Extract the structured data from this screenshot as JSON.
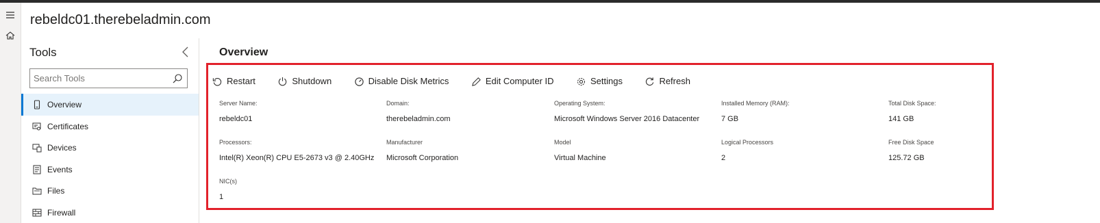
{
  "server": {
    "name": "rebeldc01.therebeladmin.com"
  },
  "tools_pane": {
    "title": "Tools",
    "search_placeholder": "Search Tools",
    "items": [
      {
        "label": "Overview",
        "icon": "server-icon",
        "active": true
      },
      {
        "label": "Certificates",
        "icon": "certificate-icon",
        "active": false
      },
      {
        "label": "Devices",
        "icon": "devices-icon",
        "active": false
      },
      {
        "label": "Events",
        "icon": "events-icon",
        "active": false
      },
      {
        "label": "Files",
        "icon": "files-icon",
        "active": false
      },
      {
        "label": "Firewall",
        "icon": "firewall-icon",
        "active": false
      }
    ]
  },
  "overview": {
    "title": "Overview",
    "toolbar": {
      "restart": "Restart",
      "shutdown": "Shutdown",
      "disable_disk_metrics": "Disable Disk Metrics",
      "edit_computer_id": "Edit Computer ID",
      "settings": "Settings",
      "refresh": "Refresh"
    },
    "properties": {
      "server_name": {
        "label": "Server Name:",
        "value": "rebeldc01"
      },
      "domain": {
        "label": "Domain:",
        "value": "therebeladmin.com"
      },
      "os": {
        "label": "Operating System:",
        "value": "Microsoft Windows Server 2016 Datacenter"
      },
      "memory": {
        "label": "Installed Memory (RAM):",
        "value": "7 GB"
      },
      "total_disk": {
        "label": "Total Disk Space:",
        "value": "141 GB"
      },
      "processors": {
        "label": "Processors:",
        "value": "Intel(R) Xeon(R) CPU E5-2673 v3 @ 2.40GHz"
      },
      "manufacturer": {
        "label": "Manufacturer",
        "value": "Microsoft Corporation"
      },
      "model": {
        "label": "Model",
        "value": "Virtual Machine"
      },
      "logical_processors": {
        "label": "Logical Processors",
        "value": "2"
      },
      "free_disk": {
        "label": "Free Disk Space",
        "value": "125.72 GB"
      },
      "nics": {
        "label": "NIC(s)",
        "value": "1"
      }
    }
  },
  "colors": {
    "accent": "#0078d4",
    "highlight": "#e2212b",
    "selected_bg": "#e6f2fb"
  }
}
